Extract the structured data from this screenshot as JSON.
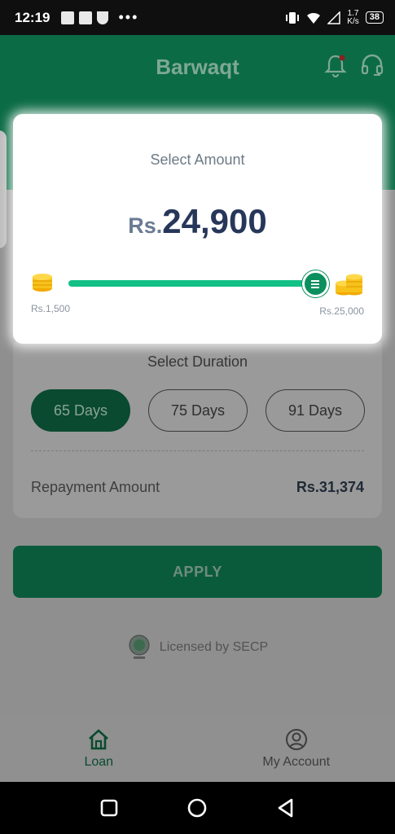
{
  "status_bar": {
    "time": "12:19",
    "net_speed_value": "1.7",
    "net_speed_unit": "K/s",
    "battery": "38"
  },
  "header": {
    "title": "Barwaqt"
  },
  "amount": {
    "label": "Select Amount",
    "currency_prefix": "Rs.",
    "value": "24,900",
    "min_label": "Rs.1,500",
    "max_label": "Rs.25,000",
    "slider_fraction": 0.9886
  },
  "duration": {
    "label": "Select Duration",
    "options": [
      {
        "label": "65 Days",
        "selected": true
      },
      {
        "label": "75 Days",
        "selected": false
      },
      {
        "label": "91 Days",
        "selected": false
      }
    ]
  },
  "repayment": {
    "label": "Repayment Amount",
    "value": "Rs.31,374"
  },
  "apply_button": {
    "label": "APPLY"
  },
  "license": {
    "text": "Licensed by SECP"
  },
  "bottom_nav": {
    "items": [
      {
        "label": "Loan",
        "icon": "home-icon",
        "active": true
      },
      {
        "label": "My Account",
        "icon": "user-circle-icon",
        "active": false
      }
    ]
  },
  "colors": {
    "brand_green": "#0b6b45",
    "slider_green": "#12c086",
    "amount_text": "#27375a"
  }
}
